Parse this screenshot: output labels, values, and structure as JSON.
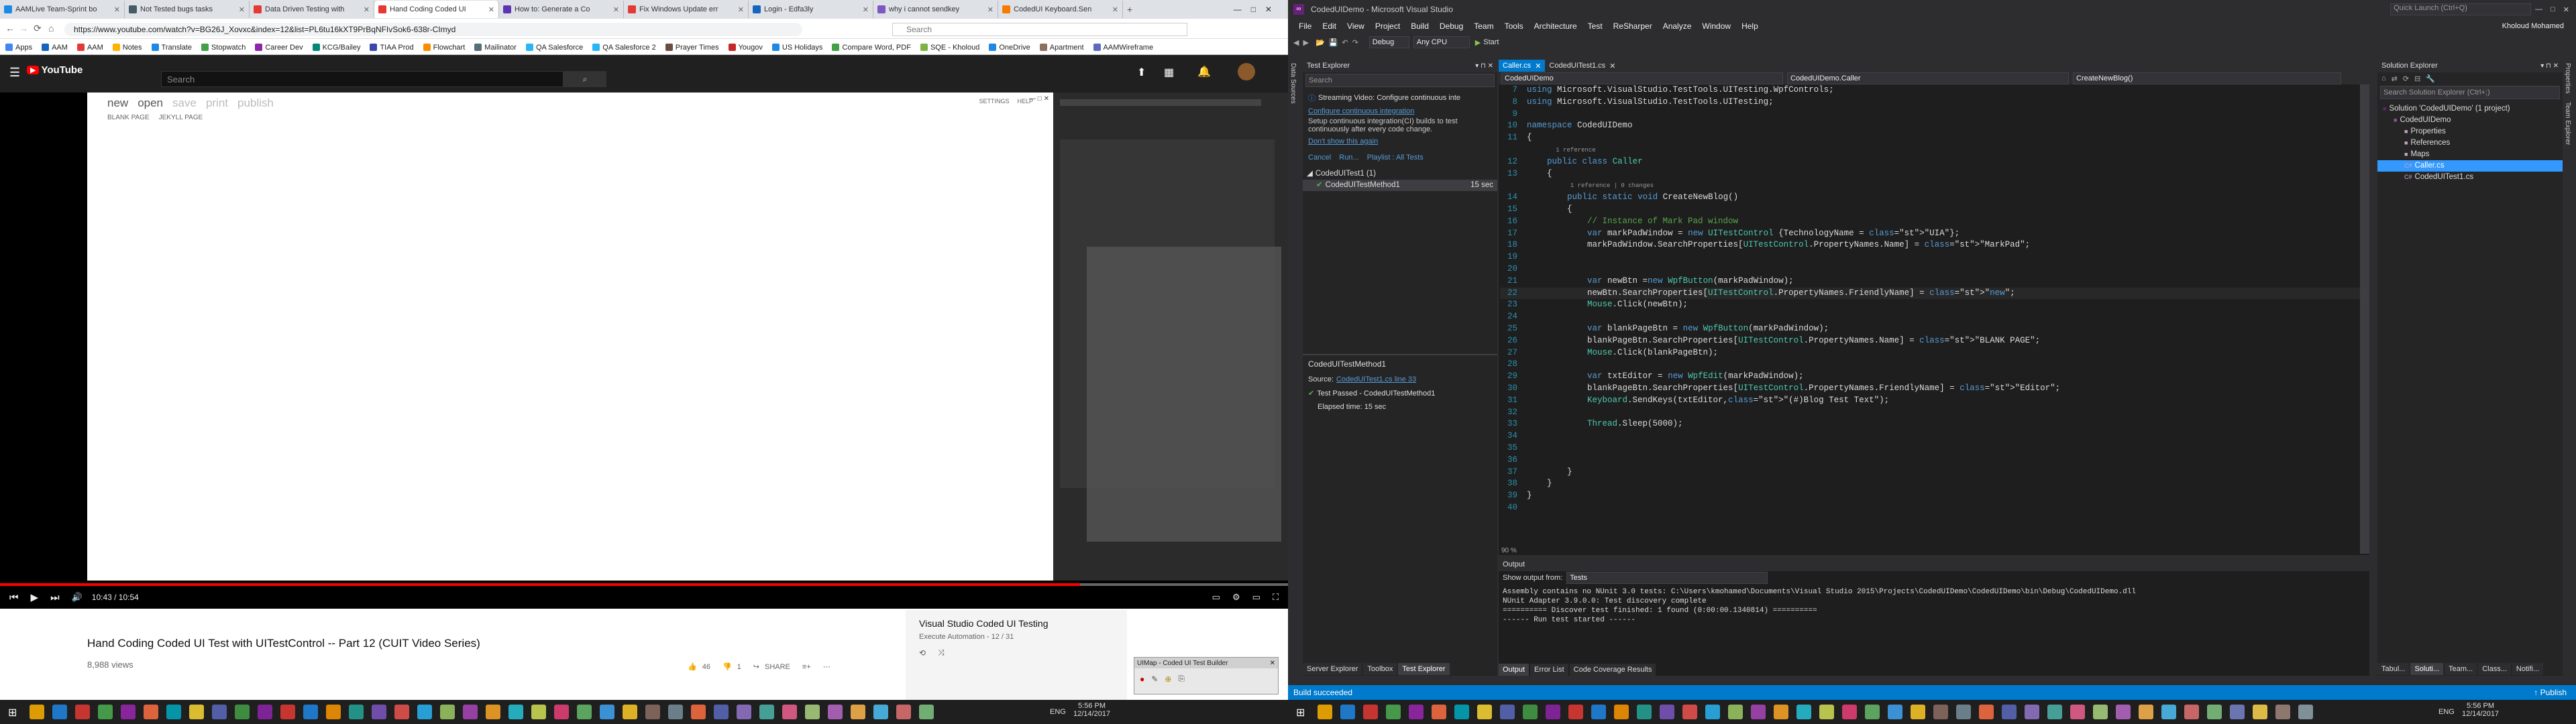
{
  "chrome": {
    "tabs": [
      {
        "label": "AAMLive Team-Sprint bo",
        "color": "#1e88e5",
        "active": false
      },
      {
        "label": "Not Tested bugs tasks",
        "color": "#455a64",
        "active": false
      },
      {
        "label": "Data Driven Testing with",
        "color": "#e53935",
        "active": false
      },
      {
        "label": "Hand Coding Coded UI",
        "color": "#e53935",
        "active": true
      },
      {
        "label": "How to: Generate a Co",
        "color": "#5e35b1",
        "active": false
      },
      {
        "label": "Fix Windows Update err",
        "color": "#e53935",
        "active": false
      },
      {
        "label": "Login - Edfa3ly",
        "color": "#1565c0",
        "active": false
      },
      {
        "label": "why i cannot sendkey",
        "color": "#7e57c2",
        "active": false
      },
      {
        "label": "CodedUI Keyboard.Sen",
        "color": "#f57c00",
        "active": false
      }
    ],
    "url": "https://www.youtube.com/watch?v=BG26J_Xovxc&index=12&list=PL6tu16kXT9PrBqNFIvSok6-638r-CImyd",
    "search_placeholder": "Search",
    "bookmarks": [
      {
        "label": "AAM",
        "color": "#1565c0"
      },
      {
        "label": "AAM",
        "color": "#e53935"
      },
      {
        "label": "Notes",
        "color": "#ffb300"
      },
      {
        "label": "Translate",
        "color": "#1e88e5"
      },
      {
        "label": "Stopwatch",
        "color": "#43a047"
      },
      {
        "label": "Career Dev",
        "color": "#8e24aa"
      },
      {
        "label": "KCG/Bailey",
        "color": "#00897b"
      },
      {
        "label": "TIAA Prod",
        "color": "#3949ab"
      },
      {
        "label": "Flowchart",
        "color": "#fb8c00"
      },
      {
        "label": "Mailinator",
        "color": "#546e7a"
      },
      {
        "label": "QA Salesforce",
        "color": "#29b6f6"
      },
      {
        "label": "QA Salesforce 2",
        "color": "#29b6f6"
      },
      {
        "label": "Prayer Times",
        "color": "#6d4c41"
      },
      {
        "label": "Yougov",
        "color": "#c62828"
      },
      {
        "label": "US Holidays",
        "color": "#1e88e5"
      },
      {
        "label": "Compare Word, PDF",
        "color": "#43a047"
      },
      {
        "label": "SQE - Kholoud",
        "color": "#7cb342"
      },
      {
        "label": "OneDrive",
        "color": "#1e88e5"
      },
      {
        "label": "Apartment",
        "color": "#8d6e63"
      },
      {
        "label": "AAMWireframe",
        "color": "#5c6bc0"
      }
    ]
  },
  "youtube": {
    "logo": "YouTube",
    "search_placeholder": "Search",
    "video_app": {
      "menu": [
        "new",
        "open",
        "save",
        "print",
        "publish"
      ],
      "sub": [
        "BLANK PAGE",
        "JEKYLL PAGE"
      ],
      "topright": [
        "SETTINGS",
        "HELP"
      ]
    },
    "time": "10:43 / 10:54",
    "title": "Hand Coding Coded UI Test with UITestControl -- Part 12 (CUIT Video Series)",
    "views": "8,988 views",
    "likes": "46",
    "dislikes": "1",
    "share": "SHARE",
    "playlist_title": "Visual Studio Coded UI Testing",
    "playlist_sub": "Execute Automation - 12 / 31",
    "uimap_title": "UIMap - Coded UI Test Builder"
  },
  "vs": {
    "title": "CodedUIDemo - Microsoft Visual Studio",
    "quick_launch": "Quick Launch (Ctrl+Q)",
    "user": "Kholoud Mohamed",
    "menu": [
      "File",
      "Edit",
      "View",
      "Project",
      "Build",
      "Debug",
      "Team",
      "Tools",
      "Architecture",
      "Test",
      "ReSharper",
      "Analyze",
      "Window",
      "Help"
    ],
    "config": "Debug",
    "platform": "Any CPU",
    "start": "Start",
    "test_explorer": {
      "title": "Test Explorer",
      "search": "Search",
      "banner_title": "Streaming Video: Configure continuous inte",
      "banner_link": "Configure continuous integration",
      "banner_text": "Setup continuous integration(CI) builds to test continuously after every code change.",
      "banner_dismiss": "Don't show this again",
      "actions": [
        "Cancel",
        "Run...",
        "Playlist : All Tests"
      ],
      "group": "CodedUITest1 (1)",
      "test": "CodedUITestMethod1",
      "test_time": "15 sec",
      "detail_title": "CodedUITestMethod1",
      "detail_source_label": "Source:",
      "detail_source": "CodedUITest1.cs line 33",
      "detail_passed": "Test Passed - CodedUITestMethod1",
      "detail_elapsed": "Elapsed time: 15 sec"
    },
    "editor": {
      "tabs": [
        "Caller.cs",
        "CodedUITest1.cs"
      ],
      "nav": [
        "CodedUIDemo",
        "CodedUIDemo.Caller",
        "CreateNewBlog()"
      ],
      "zoom": "90 %",
      "lines": [
        {
          "n": "7",
          "t": "using Microsoft.VisualStudio.TestTools.UITesting.WpfControls;"
        },
        {
          "n": "8",
          "t": "using Microsoft.VisualStudio.TestTools.UITesting;"
        },
        {
          "n": "9",
          "t": ""
        },
        {
          "n": "10",
          "t": "namespace CodedUIDemo"
        },
        {
          "n": "11",
          "t": "{"
        },
        {
          "n": "",
          "t": "        1 reference"
        },
        {
          "n": "12",
          "t": "    public class Caller"
        },
        {
          "n": "13",
          "t": "    {"
        },
        {
          "n": "",
          "t": "            1 reference | 0 changes"
        },
        {
          "n": "14",
          "t": "        public static void CreateNewBlog()"
        },
        {
          "n": "15",
          "t": "        {"
        },
        {
          "n": "16",
          "t": "            // Instance of Mark Pad window"
        },
        {
          "n": "17",
          "t": "            var markPadWindow = new UITestControl {TechnologyName = \"UIA\"};"
        },
        {
          "n": "18",
          "t": "            markPadWindow.SearchProperties[UITestControl.PropertyNames.Name] = \"MarkPad\";"
        },
        {
          "n": "19",
          "t": ""
        },
        {
          "n": "20",
          "t": ""
        },
        {
          "n": "21",
          "t": "            var newBtn =new WpfButton(markPadWindow);"
        },
        {
          "n": "22",
          "t": "            newBtn.SearchProperties[UITestControl.PropertyNames.FriendlyName] = \"new\";"
        },
        {
          "n": "23",
          "t": "            Mouse.Click(newBtn);"
        },
        {
          "n": "24",
          "t": ""
        },
        {
          "n": "25",
          "t": "            var blankPageBtn = new WpfButton(markPadWindow);"
        },
        {
          "n": "26",
          "t": "            blankPageBtn.SearchProperties[UITestControl.PropertyNames.Name] = \"BLANK PAGE\";"
        },
        {
          "n": "27",
          "t": "            Mouse.Click(blankPageBtn);"
        },
        {
          "n": "28",
          "t": ""
        },
        {
          "n": "29",
          "t": "            var txtEditor = new WpfEdit(markPadWindow);"
        },
        {
          "n": "30",
          "t": "            blankPageBtn.SearchProperties[UITestControl.PropertyNames.FriendlyName] = \"Editor\";"
        },
        {
          "n": "31",
          "t": "            Keyboard.SendKeys(txtEditor,\"(#)Blog Test Text\");"
        },
        {
          "n": "32",
          "t": ""
        },
        {
          "n": "33",
          "t": "            Thread.Sleep(5000);"
        },
        {
          "n": "34",
          "t": ""
        },
        {
          "n": "35",
          "t": ""
        },
        {
          "n": "36",
          "t": ""
        },
        {
          "n": "37",
          "t": "        }"
        },
        {
          "n": "38",
          "t": "    }"
        },
        {
          "n": "39",
          "t": "}"
        },
        {
          "n": "40",
          "t": ""
        }
      ]
    },
    "output": {
      "title": "Output",
      "show_from": "Show output from:",
      "source": "Tests",
      "lines": [
        "Assembly contains no NUnit 3.0 tests: C:\\Users\\kmohamed\\Documents\\Visual Studio 2015\\Projects\\CodedUIDemo\\CodedUIDemo\\bin\\Debug\\CodedUIDemo.dll",
        "NUnit Adapter 3.9.0.0: Test discovery complete",
        "========== Discover test finished: 1 found (0:00:00.1340814) ==========",
        "------ Run test started ------"
      ],
      "tabs": [
        "Output",
        "Error List",
        "Code Coverage Results"
      ]
    },
    "left_bottom_tabs": [
      "Server Explorer",
      "Toolbox",
      "Test Explorer"
    ],
    "solution_explorer": {
      "title": "Solution Explorer",
      "search": "Search Solution Explorer (Ctrl+;)",
      "items": [
        {
          "label": "Solution 'CodedUIDemo' (1 project)",
          "indent": 0
        },
        {
          "label": "CodedUIDemo",
          "indent": 1
        },
        {
          "label": "Properties",
          "indent": 2
        },
        {
          "label": "References",
          "indent": 2
        },
        {
          "label": "Maps",
          "indent": 2
        },
        {
          "label": "Caller.cs",
          "indent": 2
        },
        {
          "label": "CodedUITest1.cs",
          "indent": 2
        }
      ],
      "tabs": [
        "Tabul...",
        "Soluti...",
        "Team...",
        "Class...",
        "Notifi..."
      ]
    },
    "status": "Build succeeded",
    "publish": "Publish"
  },
  "taskbar": {
    "left": {
      "lang": "ENG",
      "time": "5:56 PM",
      "date": "12/14/2017"
    },
    "right": {
      "lang": "ENG",
      "time": "5:56 PM",
      "date": "12/14/2017"
    }
  }
}
